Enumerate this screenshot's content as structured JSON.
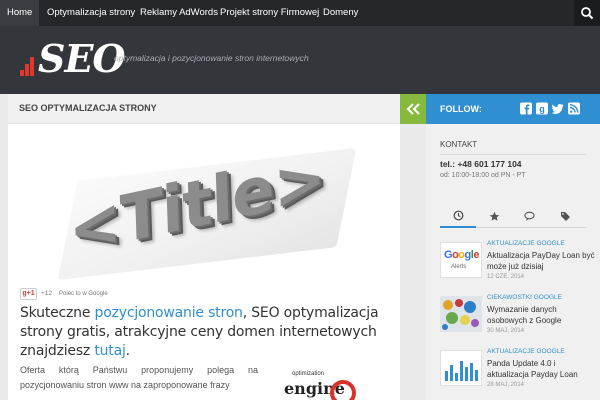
{
  "nav": {
    "items": [
      {
        "label": "Home"
      },
      {
        "label": "Optymalizacja strony"
      },
      {
        "label": "Reklamy AdWords"
      },
      {
        "label": "Projekt strony Firmowej"
      },
      {
        "label": "Domeny"
      }
    ],
    "search_icon": "search-icon"
  },
  "header": {
    "logo_text": "SEO",
    "tagline": "optymalizacja i pozycjonowanie stron internetowych"
  },
  "main": {
    "title": "SEO OPTYMALIZACJA STRONY",
    "image_text": "<Title>",
    "gplus": {
      "button": "g+1",
      "count": "+12",
      "recommend": "Polec to w Google"
    },
    "lead": {
      "before": "Skuteczne ",
      "link1": "pozycjonowanie stron",
      "middle": ", SEO optymalizacja strony gratis, atrakcyjne ceny domen internetowych znajdziesz ",
      "link2": "tutaj",
      "after": "."
    },
    "paragraph": "Oferta którą Państwu proponujemy polega na pozycjonowaniu stron www na zaproponowane frazy",
    "engine_image": {
      "small": "optimization",
      "big": "engine"
    }
  },
  "sidebar": {
    "follow_label": "FOLLOW:",
    "social_icons": [
      "facebook-icon",
      "google-plus-icon",
      "twitter-icon",
      "rss-icon"
    ],
    "contact_title": "KONTAKT",
    "phone": "tel.: +48 601 177 104",
    "hours": "od: 10:00-18:00 od PN - PT",
    "tabs": [
      "clock-icon",
      "star-icon",
      "comments-icon",
      "tags-icon"
    ],
    "posts": [
      {
        "category": "AKTUALIZACJE GOOGLE",
        "title": "Aktualizacja PayDay Loan być może już dzisiaj",
        "date": "12 CZE, 2014",
        "thumb_text": "Google",
        "thumb_sub": "Alerts"
      },
      {
        "category": "CIEKAWOSTKI GOOGLE",
        "title": "Wymazanie danych osobowych z Google",
        "date": "30 MAJ, 2014"
      },
      {
        "category": "AKTUALIZACJE GOOGLE",
        "title": "Panda Update 4.0 i aktualizacja Payday Loan",
        "date": "28 MAJ, 2014"
      }
    ]
  },
  "colors": {
    "accent": "#2f8fd0",
    "green": "#85ba3e",
    "red": "#e5362d",
    "nav_bg": "#26272b",
    "header_bg": "#33363b"
  }
}
